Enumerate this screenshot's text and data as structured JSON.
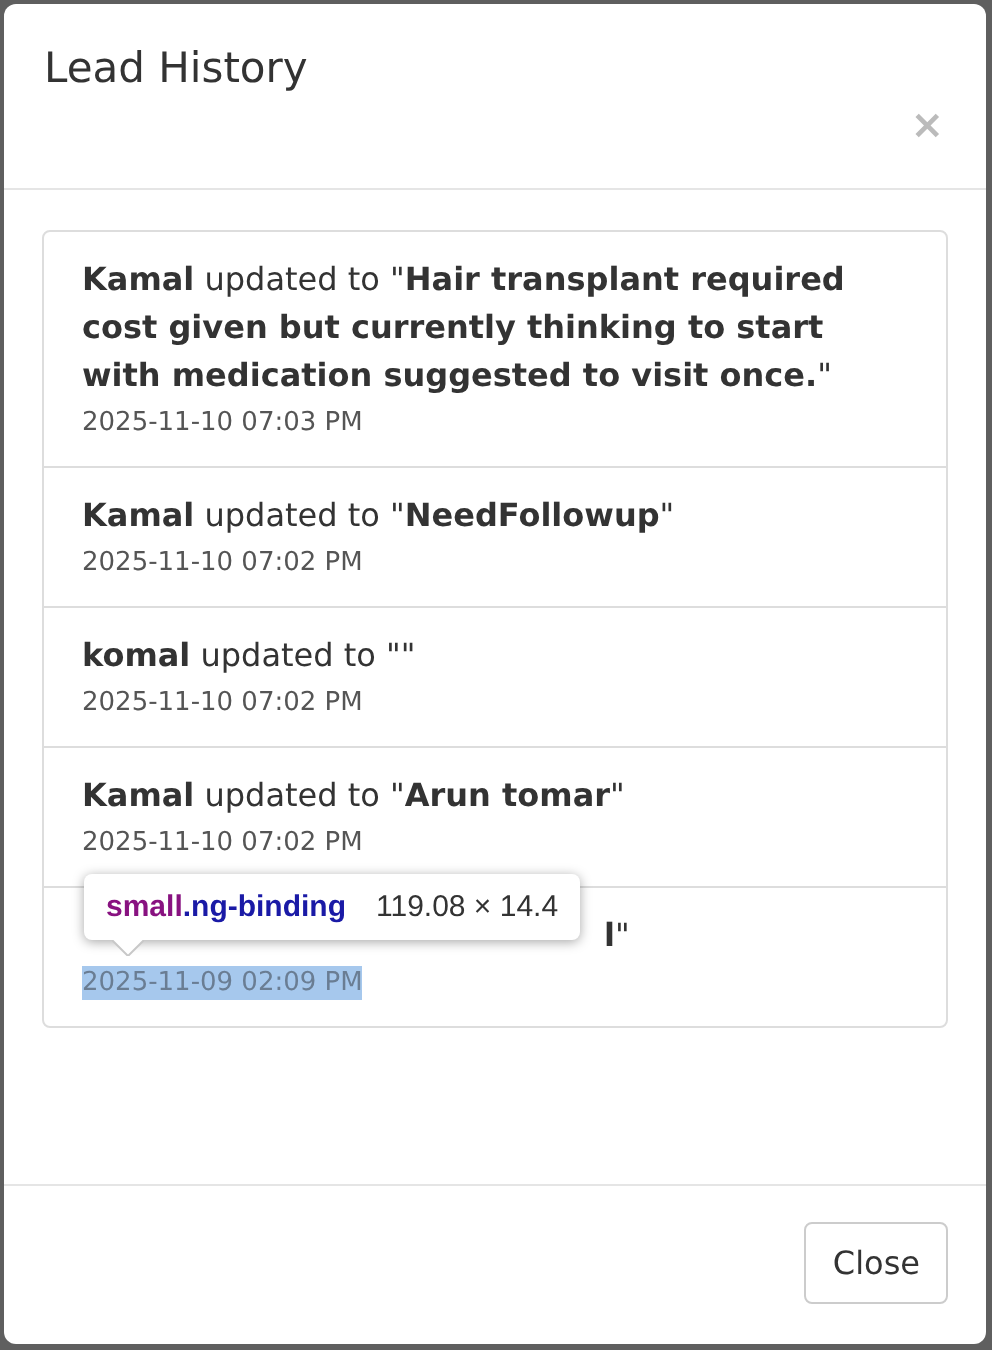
{
  "dialog": {
    "title": "Lead History",
    "close_icon": "×"
  },
  "history": [
    {
      "message": "**Kamal** updated to \"**Hair transplant required cost given but currently thinking to start with medication suggested to visit once.**\"",
      "date": "2025-11-10 07:03 PM",
      "highlighted": false,
      "covered": false
    },
    {
      "message": "**Kamal** updated to \"**NeedFollowup**\"",
      "date": "2025-11-10 07:02 PM",
      "highlighted": false,
      "covered": false
    },
    {
      "message": "**komal** updated to \"\"",
      "date": "2025-11-10 07:02 PM",
      "highlighted": false,
      "covered": false
    },
    {
      "message": "**Kamal** updated to \"**Arun tomar**\"",
      "date": "2025-11-10 07:02 PM",
      "highlighted": false,
      "covered": false
    },
    {
      "message": "**l**\"",
      "date": "2025-11-09 02:09 PM",
      "highlighted": true,
      "covered": true
    }
  ],
  "inspector_tooltip": {
    "tag": "small",
    "class": ".ng-binding",
    "size": "119.08 × 14.4"
  },
  "footer": {
    "button": "Close"
  }
}
